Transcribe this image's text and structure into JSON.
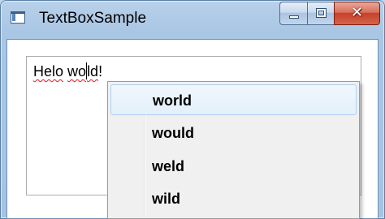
{
  "window": {
    "title": "TextBoxSample",
    "controls": {
      "minimize": "minimize",
      "maximize": "maximize",
      "close": "✕"
    }
  },
  "textbox": {
    "before_caret": "Helo wo",
    "after_caret": "ld!",
    "misspelled": [
      "Helo",
      "wold"
    ]
  },
  "suggestions": {
    "items": [
      {
        "label": "world",
        "highlighted": true
      },
      {
        "label": "would",
        "highlighted": false
      },
      {
        "label": "weld",
        "highlighted": false
      },
      {
        "label": "wild",
        "highlighted": false
      }
    ]
  },
  "colors": {
    "title_bar": "#b9d1ea",
    "close_button": "#c7402a",
    "highlight": "#e3effa",
    "spell_error_underline": "#e81123"
  }
}
